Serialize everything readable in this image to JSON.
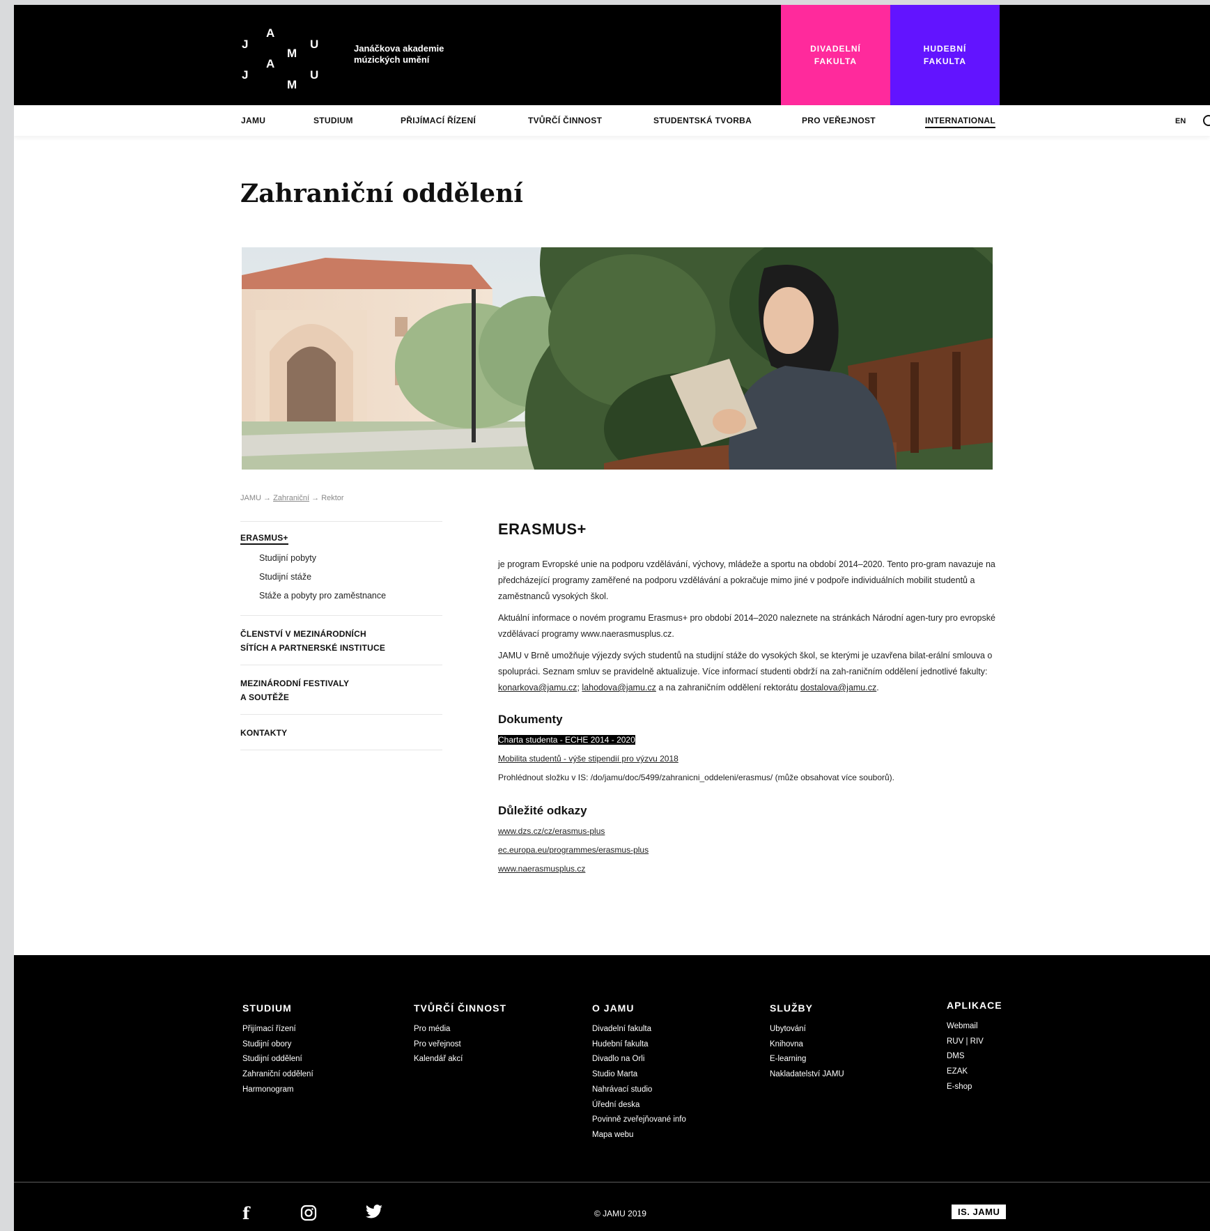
{
  "header": {
    "logo_letters": [
      "J",
      "A",
      "U",
      "M",
      "J",
      "A",
      "U",
      "M"
    ],
    "logo_line1": "Janáčkova akademie",
    "logo_line2": "múzických umění",
    "faculty1_line1": "DIVADELNÍ",
    "faculty1_line2": "FAKULTA",
    "faculty2_line1": "HUDEBNÍ",
    "faculty2_line2": "FAKULTA",
    "faculty1_color": "#ff2a9c",
    "faculty2_color": "#6214ff"
  },
  "nav": {
    "items": [
      "JAMU",
      "STUDIUM",
      "PŘIJÍMACÍ ŘÍZENÍ",
      "TVŮRČÍ ČINNOST",
      "STUDENTSKÁ TVORBA",
      "PRO VEŘEJNOST",
      "INTERNATIONAL"
    ],
    "active": "INTERNATIONAL",
    "lang": "EN",
    "search_icon": "search-icon"
  },
  "page_title": "Zahraniční oddělení",
  "breadcrumb": {
    "part1": "JAMU",
    "arrow": "→",
    "part2": "Zahraniční",
    "part3": "Rektor"
  },
  "sidebar": {
    "section1_title": "ERASMUS+",
    "subitems": [
      "Studijní pobyty",
      "Studijní stáže",
      "Stáže a pobyty pro zaměstnance"
    ],
    "section2_line1": "ČLENSTVÍ V MEZINÁRODNÍCH",
    "section2_line2": "SÍTÍCH A PARTNERSKÉ INSTITUCE",
    "section3_line1": "MEZINÁRODNÍ FESTIVALY",
    "section3_line2": "A SOUTĚŽE",
    "section4_title": "KONTAKTY"
  },
  "content": {
    "heading": "ERASMUS+",
    "p1": "je program Evropské unie na podporu vzdělávání, výchovy, mládeže a sportu na období 2014–2020. Tento pro-gram navazuje na předcházející programy zaměřené na podporu vzdělávání a pokračuje mimo jiné v podpoře individuálních mobilit studentů a zaměstnanců vysokých škol.",
    "p2": "Aktuální informace o novém programu Erasmus+ pro období 2014–2020 naleznete na stránkách Národní agen-tury pro evropské vzdělávací programy www.naerasmusplus.cz.",
    "p3_a": "JAMU v Brně umožňuje výjezdy svých studentů na studijní stáže do vysokých škol, se kterými je uzavřena bilat-erální smlouva o spolupráci. Seznam smluv se pravidelně aktualizuje. Více informací studenti obdrží na zah-raničním oddělení jednotlivé fakulty: ",
    "p3_email1": "konarkova@jamu.cz",
    "p3_sep": "; ",
    "p3_email2": "lahodova@jamu.cz",
    "p3_b": " a na zahraničním oddělení rektorátu ",
    "p3_email3": "dostalova@jamu.cz",
    "p3_end": ".",
    "docs_heading": "Dokumenty",
    "doc1": "Charta studenta - ECHE 2014 - 2020",
    "doc2": "Mobilita studentů - výše stipendií pro výzvu 2018",
    "doc3": "Prohlédnout složku v IS: /do/jamu/doc/5499/zahranicni_oddeleni/erasmus/ (může obsahovat více souborů).",
    "links_heading": "Důležité odkazy",
    "link1": "www.dzs.cz/cz/erasmus-plus",
    "link2": "ec.europa.eu/programmes/erasmus-plus",
    "link3": "www.naerasmusplus.cz"
  },
  "footer": {
    "col1_title": "STUDIUM",
    "col1_items": [
      "Přijímací řízení",
      "Studijní obory",
      "Studijní oddělení",
      "Zahraniční oddělení",
      "Harmonogram"
    ],
    "col2_title": "TVŮRČÍ ČINNOST",
    "col2_items": [
      "Pro média",
      "Pro veřejnost",
      "Kalendář akcí"
    ],
    "col3_title": "O JAMU",
    "col3_items": [
      "Divadelní fakulta",
      "Hudební fakulta",
      "Divadlo na Orli",
      "Studio Marta",
      "Nahrávací studio",
      "Úřední deska",
      "Povinně zveřejňované info",
      "Mapa webu"
    ],
    "col4_title": "SLUŽBY",
    "col4_items": [
      "Ubytování",
      "Knihovna",
      "E-learning",
      "Nakladatelství JAMU"
    ],
    "col5_title": "APLIKACE",
    "col5_items": [
      "Webmail",
      "RUV | RIV",
      "DMS",
      "EZAK",
      "E-shop"
    ],
    "facebook_glyph": "f",
    "copyright": "© JAMU 2019",
    "is_button": "IS. JAMU"
  }
}
